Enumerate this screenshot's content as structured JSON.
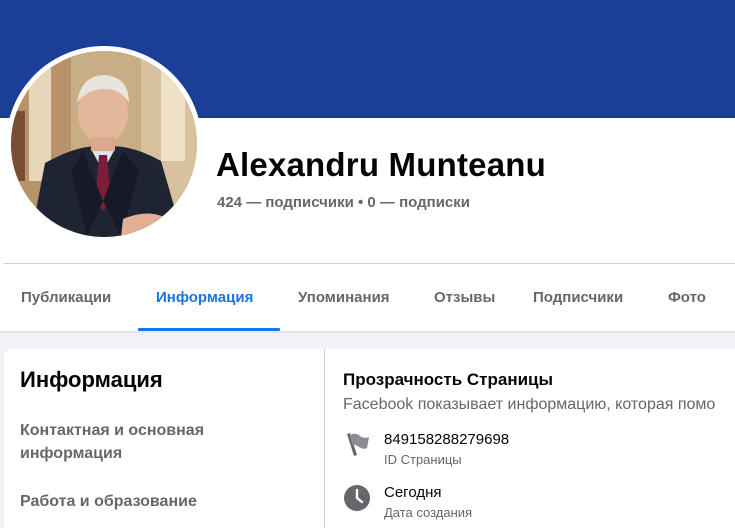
{
  "profile": {
    "name": "Alexandru Munteanu",
    "followers": "424 — подписчики",
    "separator": "•",
    "following": "0 — подписки"
  },
  "tabs": [
    {
      "label": "Публикации"
    },
    {
      "label": "Информация"
    },
    {
      "label": "Упоминания"
    },
    {
      "label": "Отзывы"
    },
    {
      "label": "Подписчики"
    },
    {
      "label": "Фото"
    }
  ],
  "active_tab": "Информация",
  "about_nav": {
    "title": "Информация",
    "items": [
      {
        "label": "Контактная и основная информация"
      },
      {
        "label": "Работа и образование"
      }
    ]
  },
  "transparency": {
    "title": "Прозрачность Страницы",
    "description": "Facebook показывает информацию, которая помо",
    "rows": [
      {
        "icon": "flag-icon",
        "value": "849158288279698",
        "label": "ID Страницы"
      },
      {
        "icon": "clock-icon",
        "value": "Сегодня",
        "label": "Дата создания"
      }
    ]
  },
  "colors": {
    "cover": "#1b3f96",
    "accent": "#1b74e4",
    "secondary_text": "#65676b"
  }
}
